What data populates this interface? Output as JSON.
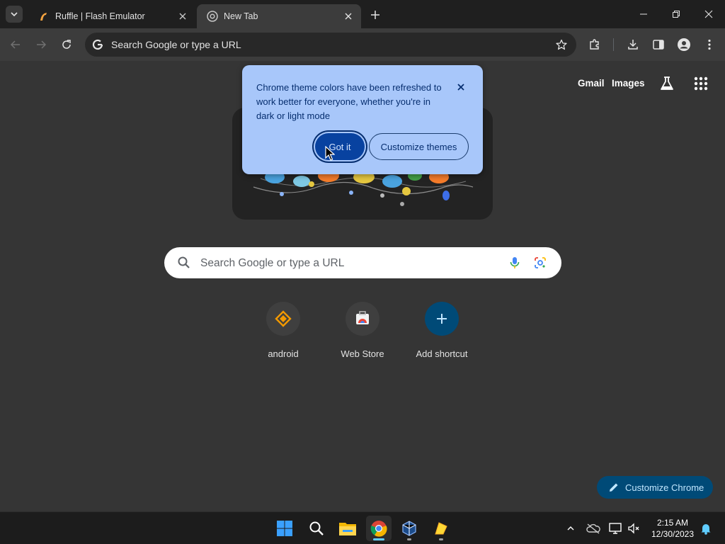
{
  "browser": {
    "tabs": [
      {
        "title": "Ruffle | Flash Emulator",
        "active": false
      },
      {
        "title": "New Tab",
        "active": true
      }
    ],
    "omnibox": {
      "text": "Search Google or type a URL"
    }
  },
  "ntp": {
    "top_links": {
      "gmail": "Gmail",
      "images": "Images"
    },
    "search": {
      "placeholder": "Search Google or type a URL"
    },
    "shortcuts": [
      {
        "label": "android",
        "icon": "android-site-icon"
      },
      {
        "label": "Web Store",
        "icon": "web-store-icon"
      },
      {
        "label": "Add shortcut",
        "icon": "plus-icon"
      }
    ],
    "customize_button": "Customize Chrome"
  },
  "promo": {
    "text": "Chrome theme colors have been refreshed to work better for everyone, whether you're in dark or light mode",
    "got_it": "Got it",
    "customize_themes": "Customize themes"
  },
  "taskbar": {
    "apps": [
      "windows-start-icon",
      "search-icon",
      "file-explorer-icon",
      "chrome-icon",
      "virtualbox-icon",
      "sticky-app-icon"
    ],
    "clock": {
      "time": "2:15 AM",
      "date": "12/30/2023"
    }
  },
  "colors": {
    "bubble": "#a8c7fa",
    "gotit": "#0842a0",
    "customize_chrome_bg": "#004a77",
    "ntp_bg": "#353535"
  }
}
